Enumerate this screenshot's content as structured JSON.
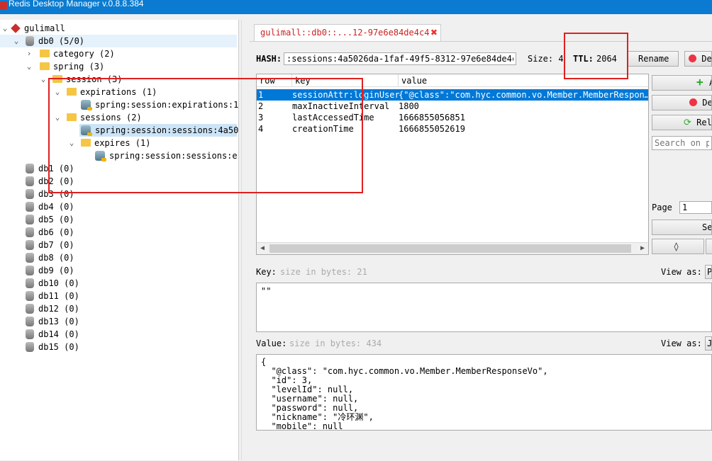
{
  "window": {
    "title": "Redis Desktop Manager v.0.8.8.384"
  },
  "tree": {
    "server": "gulimall",
    "db0": "db0  (5/0)",
    "category": "category (2)",
    "spring": "spring (3)",
    "session": "session (3)",
    "expirations": "expirations (1)",
    "expirations_key": "spring:session:expirations:1",
    "sessions": "sessions (2)",
    "sessions_key": "spring:session:sessions:4a50",
    "expires": "expires (1)",
    "expires_key": "spring:session:sessions:e",
    "dbs": [
      "db1 (0)",
      "db2 (0)",
      "db3 (0)",
      "db4 (0)",
      "db5 (0)",
      "db6 (0)",
      "db7 (0)",
      "db8 (0)",
      "db9 (0)",
      "db10 (0)",
      "db11 (0)",
      "db12 (0)",
      "db13 (0)",
      "db14 (0)",
      "db15 (0)"
    ]
  },
  "tab": {
    "label": "gulimall::db0::...12-97e6e84de4c4"
  },
  "key_header": {
    "type_label": "HASH:",
    "key_value": ":sessions:4a5026da-1faf-49f5-8312-97e6e84de4c4",
    "size_label": "Size: 4",
    "ttl_label": "TTL:",
    "ttl_value": "2064",
    "rename": "Rename",
    "delete": "De"
  },
  "table": {
    "headers": [
      "row",
      "key",
      "value"
    ],
    "rows": [
      {
        "row": "1",
        "key": "sessionAttr:loginUser",
        "value": "{\"@class\":\"com.hyc.common.vo.Member.MemberRespon…"
      },
      {
        "row": "2",
        "key": "maxInactiveInterval",
        "value": "1800"
      },
      {
        "row": "3",
        "key": "lastAccessedTime",
        "value": "1666855056851"
      },
      {
        "row": "4",
        "key": "creationTime",
        "value": "1666855052619"
      }
    ]
  },
  "side": {
    "add": "A",
    "delete": "De",
    "reload": "Rel",
    "search_placeholder": "Search on pa",
    "page_label": "Page",
    "page_value": "1",
    "set": "Se"
  },
  "key_editor": {
    "label": "Key:",
    "hint": "size in bytes: 21",
    "view_as": "View as:",
    "view_value": "P",
    "content": "\"\""
  },
  "value_editor": {
    "label": "Value:",
    "hint": "size in bytes: 434",
    "view_as": "View as:",
    "view_value": "J",
    "content": "{\n  \"@class\": \"com.hyc.common.vo.Member.MemberResponseVo\",\n  \"id\": 3,\n  \"levelId\": null,\n  \"username\": null,\n  \"password\": null,\n  \"nickname\": \"冷环渊\",\n  \"mobile\": null"
  }
}
